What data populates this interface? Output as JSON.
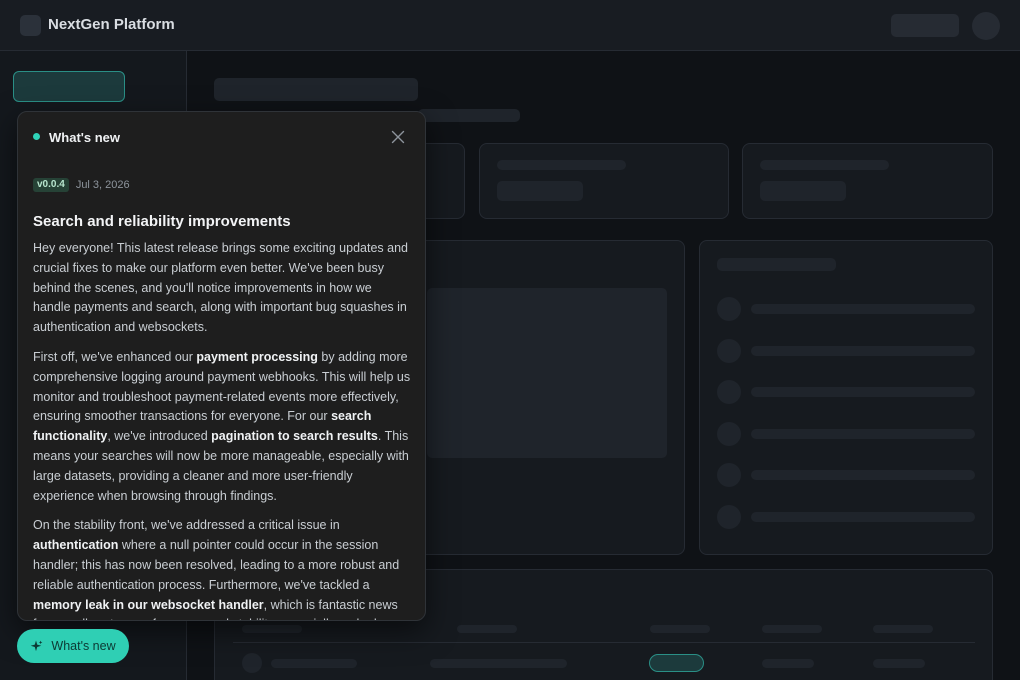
{
  "app": {
    "title": "NextGen Platform"
  },
  "panel": {
    "title": "What's new",
    "close_icon": "close-icon",
    "release": {
      "version": "v0.0.4",
      "date": "Jul 3, 2026",
      "heading": "Search and reliability improvements",
      "paragraphs": [
        [
          {
            "t": "Hey everyone! This latest release brings some exciting updates and crucial fixes to make our platform even better. We've been busy behind the scenes, and you'll notice improvements in how we handle payments and search, along with important bug squashes in authentication and websockets."
          }
        ],
        [
          {
            "t": "First off, we've enhanced our "
          },
          {
            "t": "payment processing",
            "b": true
          },
          {
            "t": " by adding more comprehensive logging around payment webhooks. This will help us monitor and troubleshoot payment-related events more effectively, ensuring smoother transactions for everyone. For our "
          },
          {
            "t": "search functionality",
            "b": true
          },
          {
            "t": ", we've introduced "
          },
          {
            "t": "pagination to search results",
            "b": true
          },
          {
            "t": ". This means your searches will now be more manageable, especially with large datasets, providing a cleaner and more user-friendly experience when browsing through findings."
          }
        ],
        [
          {
            "t": "On the stability front, we've addressed a critical issue in "
          },
          {
            "t": "authentication",
            "b": true
          },
          {
            "t": " where a null pointer could occur in the session handler; this has now been resolved, leading to a more robust and reliable authentication process. Furthermore, we've tackled a "
          },
          {
            "t": "memory leak in our websocket handler",
            "b": true
          },
          {
            "t": ", which is fantastic news for overall system performance and stability, especially under heavy load."
          }
        ]
      ]
    }
  },
  "fab": {
    "label": "What's new",
    "icon": "sparkle-icon"
  },
  "colors": {
    "accent": "#2fcfb4",
    "badge_bg": "#264236"
  }
}
